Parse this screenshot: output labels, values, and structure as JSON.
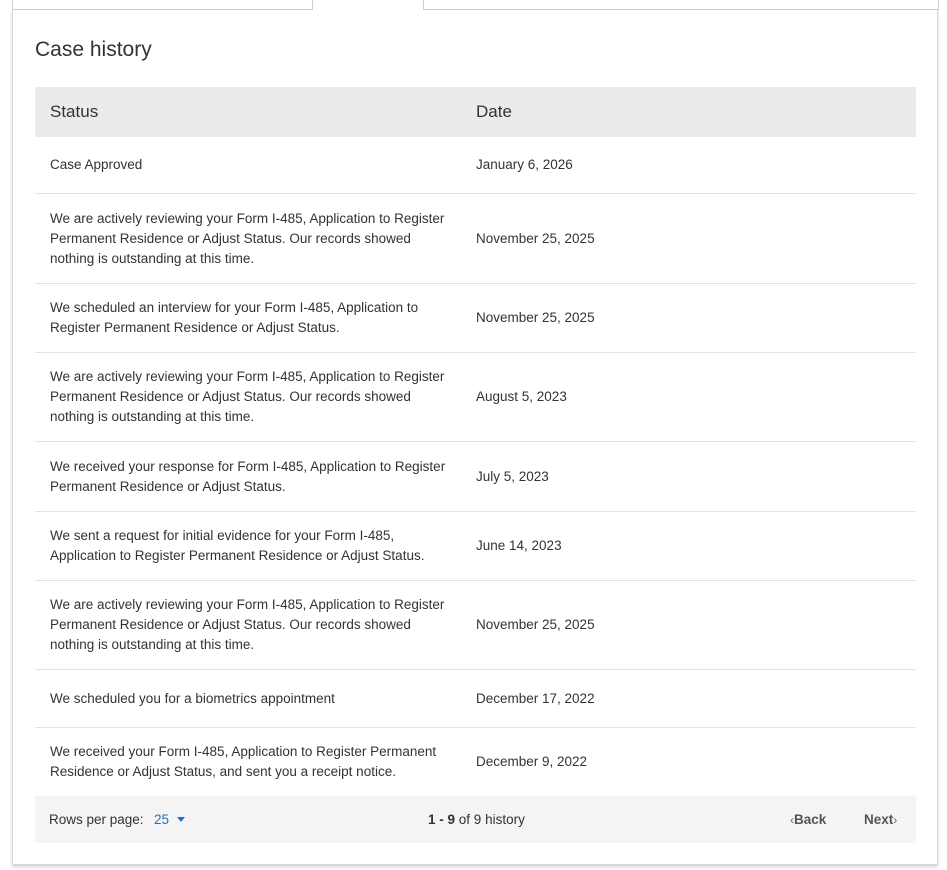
{
  "section_title": "Case history",
  "table": {
    "headers": {
      "status": "Status",
      "date": "Date"
    },
    "rows": [
      {
        "status": "Case Approved",
        "date": "January 6, 2026"
      },
      {
        "status": "We are actively reviewing your Form I-485, Application to Register Permanent Residence or Adjust Status. Our records showed nothing is outstanding at this time.",
        "date": "November 25, 2025"
      },
      {
        "status": "We scheduled an interview for your Form I-485, Application to Register Permanent Residence or Adjust Status.",
        "date": "November 25, 2025"
      },
      {
        "status": "We are actively reviewing your Form I-485, Application to Register Permanent Residence or Adjust Status. Our records showed nothing is outstanding at this time.",
        "date": "August 5, 2023"
      },
      {
        "status": "We received your response for Form I-485, Application to Register Permanent Residence or Adjust Status.",
        "date": "July 5, 2023"
      },
      {
        "status": "We sent a request for initial evidence for your Form I-485, Application to Register Permanent Residence or Adjust Status.",
        "date": "June 14, 2023"
      },
      {
        "status": "We are actively reviewing your Form I-485, Application to Register Permanent Residence or Adjust Status. Our records showed nothing is outstanding at this time.",
        "date": "November 25, 2025"
      },
      {
        "status": "We scheduled you for a biometrics appointment",
        "date": "December 17, 2022"
      },
      {
        "status": "We received your Form I-485, Application to Register Permanent Residence or Adjust Status, and sent you a receipt notice.",
        "date": "December 9, 2022"
      }
    ]
  },
  "pagination": {
    "rows_per_page_label": "Rows per page:",
    "rows_per_page_value": "25",
    "range_start": "1",
    "range_sep": " - ",
    "range_end": "9",
    "of_text": " of ",
    "total": "9",
    "unit": " history",
    "back_label": "Back",
    "next_label": "Next"
  },
  "colors": {
    "link": "#1a73c9",
    "header_bg": "#ebebeb",
    "footer_bg": "#f4f4f4"
  }
}
